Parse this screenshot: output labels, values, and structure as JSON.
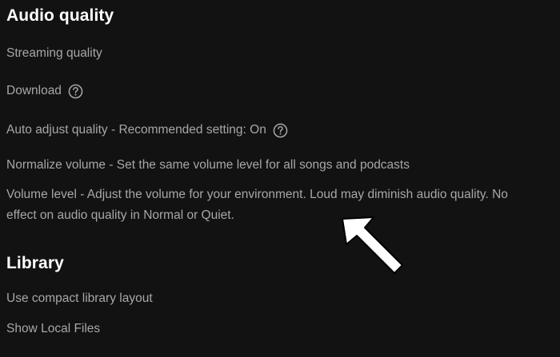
{
  "audio_quality": {
    "title": "Audio quality",
    "streaming_quality": "Streaming quality",
    "download": "Download",
    "auto_adjust": "Auto adjust quality - Recommended setting: On",
    "normalize_volume": "Normalize volume - Set the same volume level for all songs and podcasts",
    "volume_level": "Volume level - Adjust the volume for your environment. Loud may diminish audio quality. No effect on audio quality in Normal or Quiet."
  },
  "library": {
    "title": "Library",
    "compact_layout": "Use compact library layout",
    "show_local_files": "Show Local Files"
  },
  "icons": {
    "help": "question-circle-icon",
    "annotation": "arrow-pointer-icon"
  },
  "colors": {
    "background": "#121212",
    "heading": "#ffffff",
    "text": "#a7a7a7",
    "annotation_arrow": "#ffffff"
  }
}
